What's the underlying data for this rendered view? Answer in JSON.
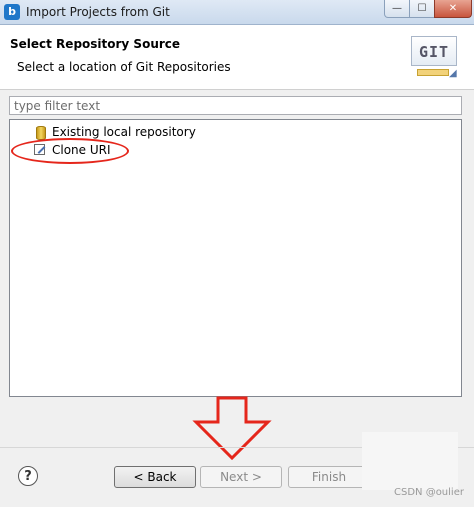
{
  "window": {
    "app_icon_letter": "b",
    "title": "Import Projects from Git",
    "minimize_glyph": "—",
    "maximize_glyph": "☐",
    "close_glyph": "✕"
  },
  "header": {
    "title": "Select Repository Source",
    "description": "Select a location of Git Repositories",
    "logo_text": "GIT",
    "logo_icon": "git-wizard-banner-icon"
  },
  "filter": {
    "placeholder": "type filter text",
    "value": ""
  },
  "tree": {
    "items": [
      {
        "label": "Existing local repository",
        "icon": "repository-icon"
      },
      {
        "label": "Clone URI",
        "icon": "clone-uri-icon"
      }
    ]
  },
  "footer": {
    "help_glyph": "?",
    "back_label": "< Back",
    "next_label": "Next >",
    "finish_label": "Finish"
  },
  "annotations": {
    "highlight_color": "#e5261b",
    "watermark": "CSDN @oulier"
  }
}
